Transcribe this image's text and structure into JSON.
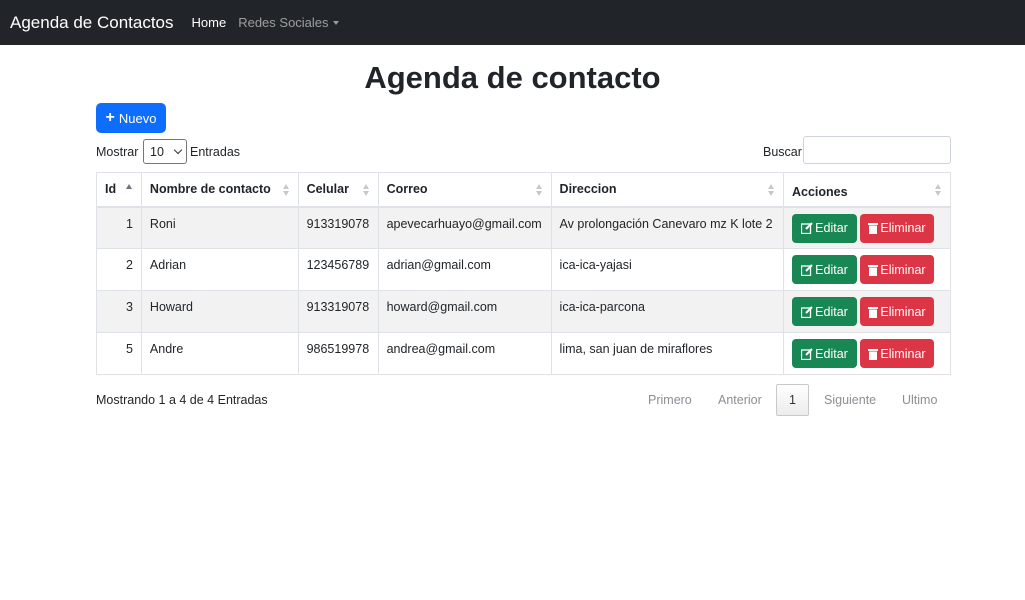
{
  "navbar": {
    "brand": "Agenda de Contactos",
    "home": "Home",
    "social": "Redes Sociales"
  },
  "page": {
    "title": "Agenda de contacto",
    "new_button": "Nuevo",
    "show_label": "Mostrar",
    "page_size": "10",
    "entries_label": "Entradas",
    "search_label": "Buscar:",
    "search_value": ""
  },
  "table": {
    "headers": {
      "id": "Id",
      "name": "Nombre de contacto",
      "cel": "Celular",
      "mail": "Correo",
      "dir": "Direccion",
      "act": "Acciones"
    },
    "rows": [
      {
        "id": "1",
        "name": "Roni",
        "cel": "913319078",
        "mail": "apevecarhuayo@gmail.com",
        "dir": "Av prolongación Canevaro mz K lote 2"
      },
      {
        "id": "2",
        "name": "Adrian",
        "cel": "123456789",
        "mail": "adrian@gmail.com",
        "dir": "ica-ica-yajasi"
      },
      {
        "id": "3",
        "name": "Howard",
        "cel": "913319078",
        "mail": "howard@gmail.com",
        "dir": "ica-ica-parcona"
      },
      {
        "id": "5",
        "name": "Andre",
        "cel": "986519978",
        "mail": "andrea@gmail.com",
        "dir": "lima, san juan de miraflores"
      }
    ],
    "edit_label": "Editar",
    "delete_label": "Eliminar"
  },
  "footer": {
    "info": "Mostrando 1 a 4 de 4 Entradas",
    "first": "Primero",
    "prev": "Anterior",
    "current": "1",
    "next": "Siguiente",
    "last": "Ultimo"
  },
  "colors": {
    "navbar": "#212529",
    "primary": "#0d6efd",
    "success": "#198754",
    "danger": "#dc3545"
  }
}
